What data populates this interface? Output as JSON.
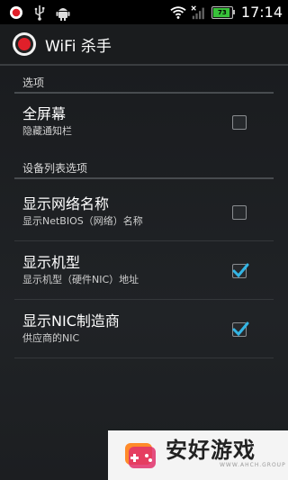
{
  "status_bar": {
    "time": "17:14",
    "battery_label": "73",
    "icons": [
      "record-notification-icon",
      "usb-icon",
      "android-debug-icon",
      "wifi-signal-icon",
      "no-signal-icon",
      "battery-icon"
    ]
  },
  "action_bar": {
    "title": "WiFi 杀手",
    "logo_icon": "app-target-logo-icon"
  },
  "sections": [
    {
      "header": "选项",
      "items": [
        {
          "title": "全屏幕",
          "summary": "隐藏通知栏",
          "checked": false
        }
      ]
    },
    {
      "header": "设备列表选项",
      "items": [
        {
          "title": "显示网络名称",
          "summary": "显示NetBIOS（网络）名称",
          "checked": false
        },
        {
          "title": "显示机型",
          "summary": "显示机型（硬件NIC）地址",
          "checked": true
        },
        {
          "title": "显示NIC制造商",
          "summary": "供应商的NIC",
          "checked": true
        }
      ]
    }
  ],
  "watermark": {
    "text": "安好游戏",
    "sub": "WWW.AHCH.GROUP"
  },
  "colors": {
    "accent": "#33b5e5",
    "background": "#1e2023",
    "battery": "#38c23a"
  }
}
